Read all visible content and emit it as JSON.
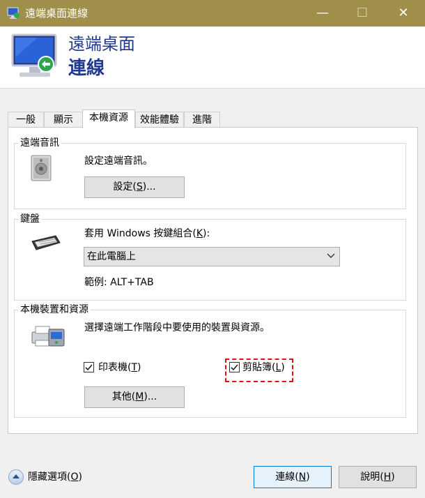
{
  "window": {
    "title": "遠端桌面連線",
    "minimize_glyph": "—",
    "maximize_glyph": "☐",
    "close_glyph": "✕"
  },
  "header": {
    "line1": "遠端桌面",
    "line2": "連線"
  },
  "tabs": [
    {
      "label": "一般",
      "selected": false
    },
    {
      "label": "顯示",
      "selected": false
    },
    {
      "label": "本機資源",
      "selected": true
    },
    {
      "label": "效能體驗",
      "selected": false
    },
    {
      "label": "進階",
      "selected": false
    }
  ],
  "audio": {
    "group_title": "遠端音訊",
    "desc": "設定遠端音訊。",
    "settings_button_pre": "設定(",
    "settings_button_key": "S",
    "settings_button_post": ")..."
  },
  "keyboard": {
    "group_title": "鍵盤",
    "label_pre": "套用 Windows 按鍵組合(",
    "label_key": "K",
    "label_post": "):",
    "selected_option": "在此電腦上",
    "example": "範例: ALT+TAB"
  },
  "devices": {
    "group_title": "本機裝置和資源",
    "desc": "選擇遠端工作階段中要使用的裝置與資源。",
    "printers": {
      "pre": "印表機(",
      "key": "T",
      "post": ")",
      "checked": true
    },
    "clipboard": {
      "pre": "剪貼簿(",
      "key": "L",
      "post": ")",
      "checked": true
    },
    "more_button_pre": "其他(",
    "more_button_key": "M",
    "more_button_post": ")..."
  },
  "footer": {
    "hide_options_pre": "隱藏選項(",
    "hide_options_key": "O",
    "hide_options_post": ")",
    "connect_pre": "連線(",
    "connect_key": "N",
    "connect_post": ")",
    "help_pre": "說明(",
    "help_key": "H",
    "help_post": ")"
  },
  "colors": {
    "titlebar": "#a08f4a",
    "header_text": "#1f3a8f",
    "highlight": "#e01010"
  }
}
